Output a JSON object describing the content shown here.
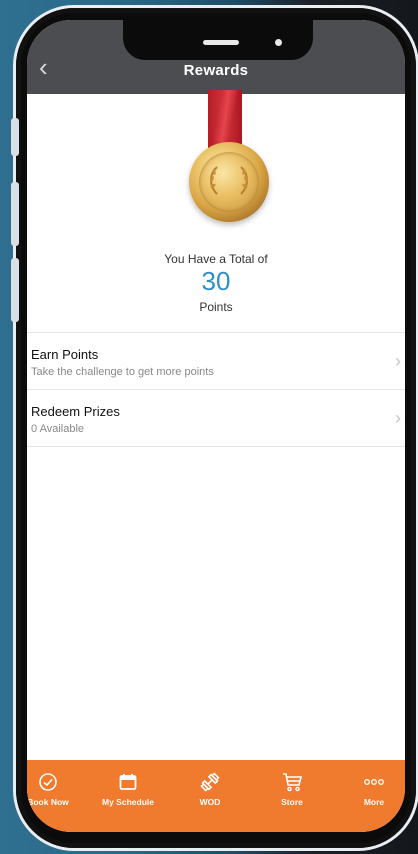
{
  "header": {
    "title": "Rewards",
    "back_label": "‹"
  },
  "summary": {
    "label": "You Have a Total of",
    "points": "30",
    "unit": "Points"
  },
  "list": [
    {
      "title": "Earn Points",
      "subtitle": "Take the challenge to get more points"
    },
    {
      "title": "Redeem Prizes",
      "subtitle": "0 Available"
    }
  ],
  "tabs": [
    {
      "label": "Book Now",
      "icon": "check-circle-icon"
    },
    {
      "label": "My Schedule",
      "icon": "calendar-icon"
    },
    {
      "label": "WOD",
      "icon": "dumbbell-icon"
    },
    {
      "label": "Store",
      "icon": "cart-icon"
    },
    {
      "label": "More",
      "icon": "more-icon"
    }
  ],
  "colors": {
    "accent": "#f07a2e",
    "points": "#2e8fc9",
    "header": "#4b4d50"
  }
}
